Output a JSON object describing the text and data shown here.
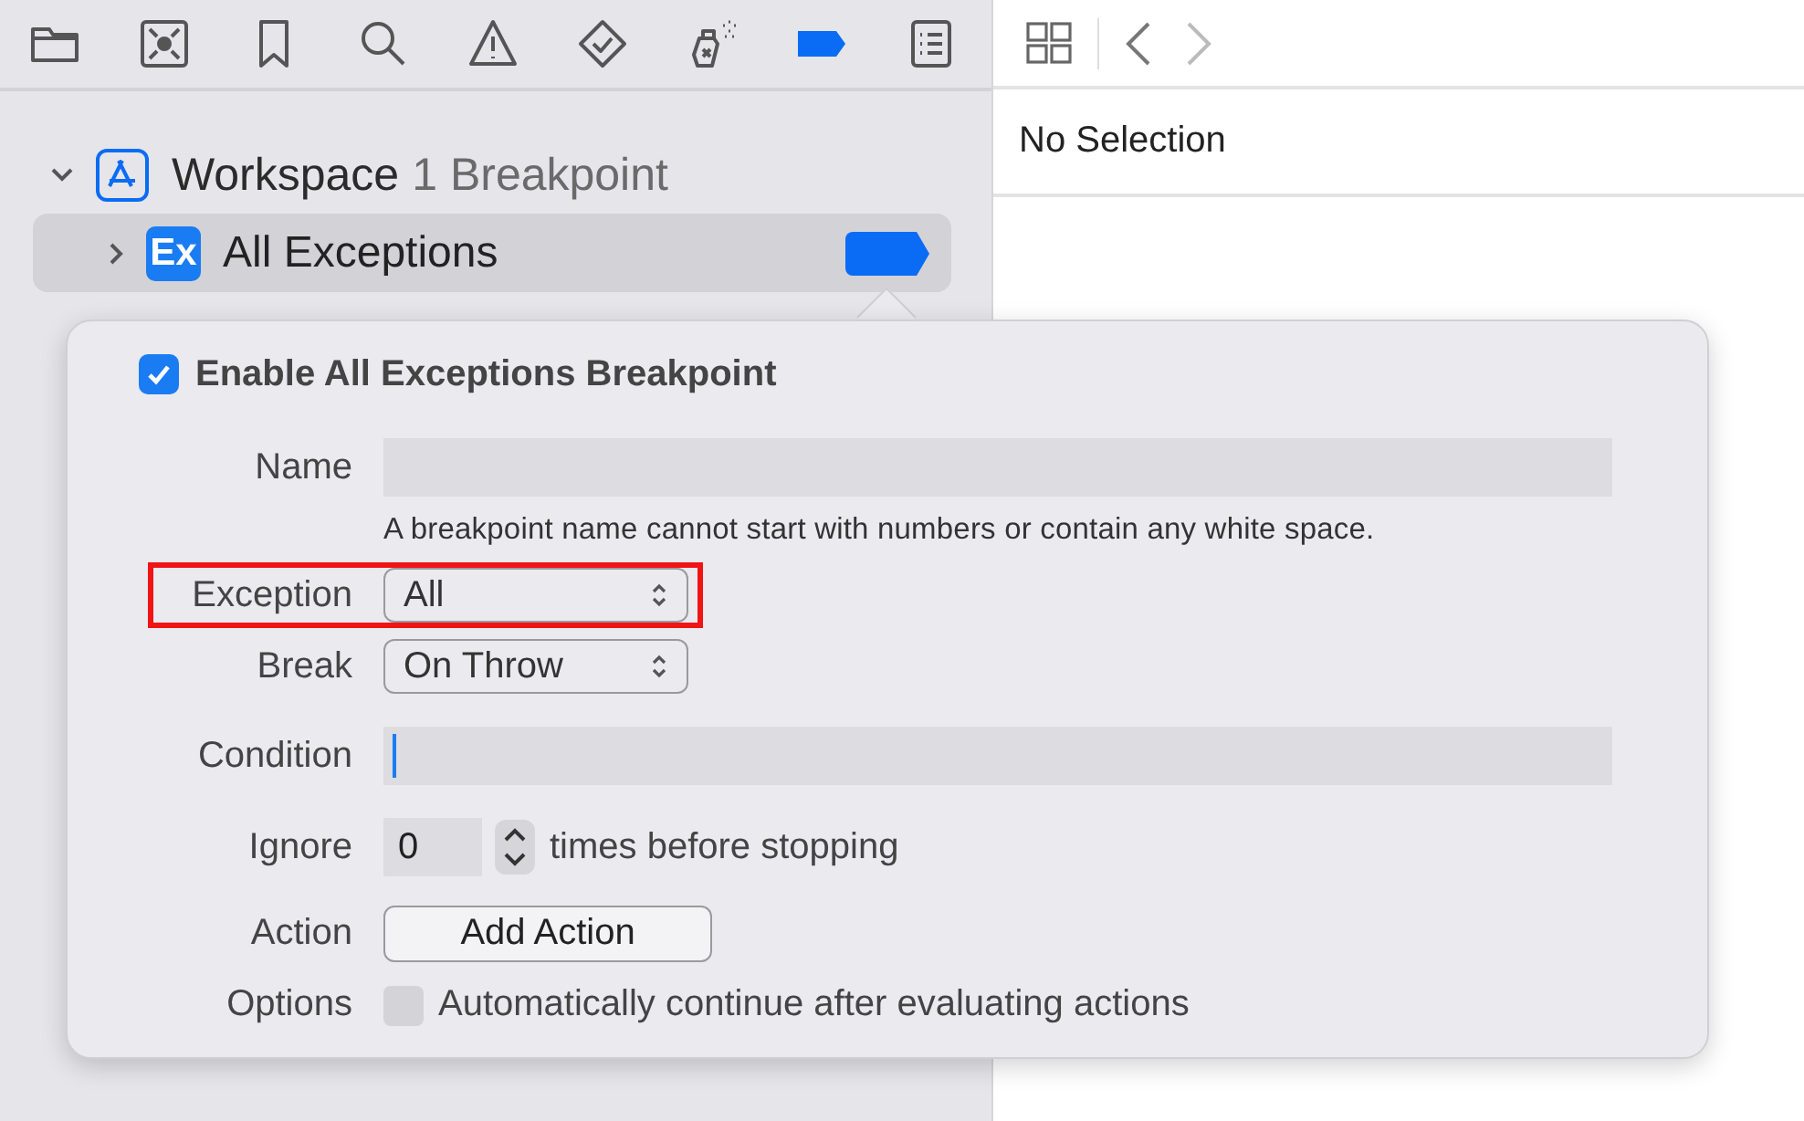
{
  "navigator_toolbar": [
    {
      "kind": "folder",
      "selected": false
    },
    {
      "kind": "symbol",
      "selected": false
    },
    {
      "kind": "bookmark",
      "selected": false
    },
    {
      "kind": "search",
      "selected": false
    },
    {
      "kind": "warning",
      "selected": false
    },
    {
      "kind": "test",
      "selected": false
    },
    {
      "kind": "spray",
      "selected": false
    },
    {
      "kind": "breakpoint",
      "selected": true
    },
    {
      "kind": "report",
      "selected": false
    }
  ],
  "tree": {
    "label": "Workspace",
    "count": "1 Breakpoint",
    "expanded": true,
    "children": [
      {
        "badge": "Ex",
        "label": "All Exceptions",
        "expanded": false,
        "selected": true,
        "enabled": true
      }
    ]
  },
  "inspector": {
    "title": "No Selection"
  },
  "popover": {
    "enable": {
      "label": "Enable All Exceptions Breakpoint",
      "checked": true
    },
    "rows": [
      {
        "kind": "text",
        "label": "Name",
        "hint": "A breakpoint name cannot start with numbers or contain any white space.",
        "highlighted": false
      },
      {
        "kind": "popup",
        "label": "Exception",
        "value": "All",
        "highlighted": true
      },
      {
        "kind": "popup",
        "label": "Break",
        "value": "On Throw",
        "highlighted": false
      },
      {
        "kind": "text",
        "label": "Condition",
        "focused": true,
        "highlighted": false
      },
      {
        "kind": "stepper",
        "label": "Ignore",
        "value": "0",
        "suffix": "times before stopping",
        "highlighted": false
      },
      {
        "kind": "button",
        "label": "Action",
        "value": "Add Action",
        "highlighted": false
      },
      {
        "kind": "checkbox",
        "label": "Options",
        "value": "Automatically continue after evaluating actions",
        "checked": false,
        "highlighted": false
      }
    ]
  }
}
